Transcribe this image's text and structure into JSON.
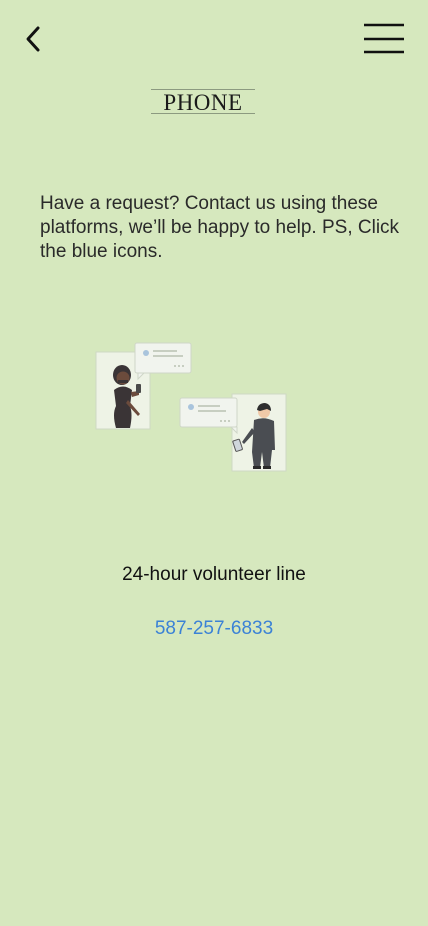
{
  "header": {
    "back_icon": "chevron-left-icon",
    "menu_icon": "hamburger-menu-icon",
    "title": "PHONE"
  },
  "intro": {
    "text": "Have a request? Contact us using these platforms, we’ll be happy to help. PS, Click the blue icons."
  },
  "illustration": {
    "icon": "two-people-texting-illustration"
  },
  "contact": {
    "label": "24-hour volunteer line",
    "phone": "587-257-6833"
  },
  "colors": {
    "background": "#d6e8be",
    "link": "#3b82d6"
  }
}
